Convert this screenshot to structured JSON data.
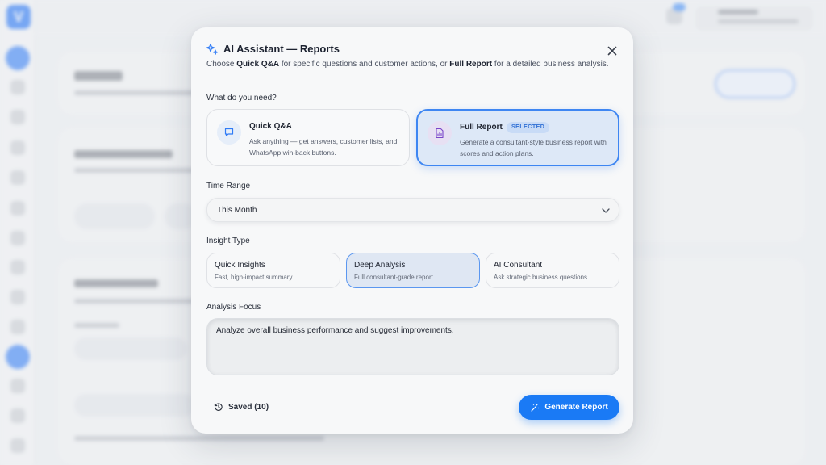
{
  "background": {
    "logo_letter": "V"
  },
  "modal": {
    "title": "AI Assistant — Reports",
    "description_parts": [
      "Choose ",
      "Quick Q&A",
      " for specific questions and customer actions, or ",
      "Full Report",
      " for a detailed business analysis."
    ],
    "need_label": "What do you need?",
    "options": [
      {
        "title": "Quick Q&A",
        "desc": "Ask anything — get answers, customer lists, and WhatsApp win-back buttons.",
        "selected": false
      },
      {
        "title": "Full Report",
        "desc": "Generate a consultant-style business report with scores and action plans.",
        "selected": true,
        "badge": "SELECTED"
      }
    ],
    "time_range_label": "Time Range",
    "time_range_value": "This Month",
    "insight_label": "Insight Type",
    "insight_options": [
      {
        "title": "Quick Insights",
        "sub": "Fast, high-impact summary",
        "selected": false
      },
      {
        "title": "Deep Analysis",
        "sub": "Full consultant-grade report",
        "selected": true
      },
      {
        "title": "AI Consultant",
        "sub": "Ask strategic business questions",
        "selected": false
      }
    ],
    "focus_label": "Analysis Focus",
    "focus_value": "Analyze overall business performance and suggest improvements.",
    "saved_label": "Saved (10)",
    "generate_label": "Generate Report"
  },
  "colors": {
    "accent": "#1a7af5",
    "selected_border": "#3e86f2"
  }
}
